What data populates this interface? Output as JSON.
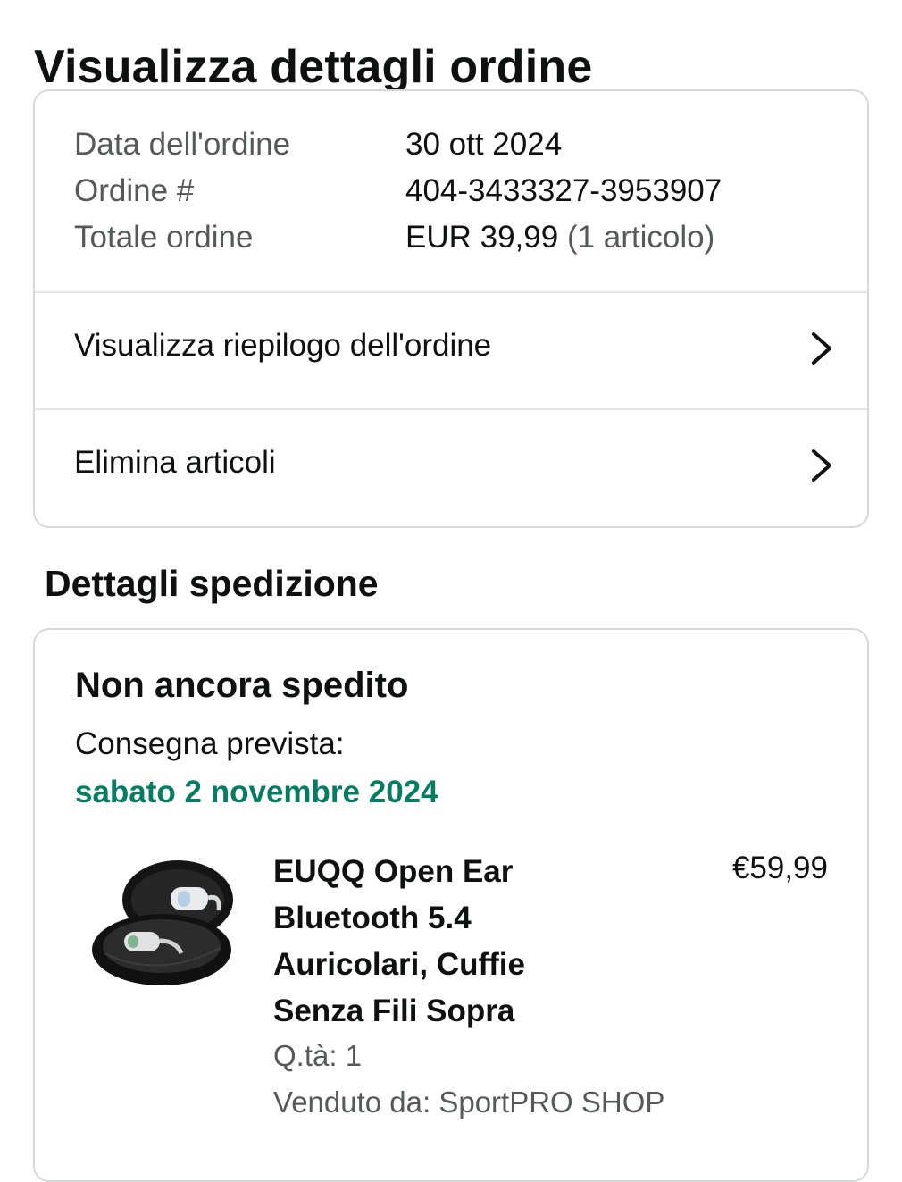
{
  "page": {
    "title": "Visualizza dettagli ordine"
  },
  "order_summary": {
    "rows": [
      {
        "label": "Data dell'ordine",
        "value": "30 ott 2024"
      },
      {
        "label": "Ordine #",
        "value": "404-3433327-3953907"
      },
      {
        "label": "Totale ordine",
        "value": "EUR 39,99",
        "value_extra": "(1 articolo)"
      }
    ],
    "links": [
      {
        "label": "Visualizza riepilogo dell'ordine",
        "icon": "chevron-right-icon"
      },
      {
        "label": "Elimina articoli",
        "icon": "chevron-right-icon"
      }
    ]
  },
  "shipment": {
    "section_title": "Dettagli spedizione",
    "status": "Non ancora spedito",
    "delivery_label": "Consegna prevista:",
    "delivery_date": "sabato 2 novembre 2024",
    "delivery_date_color": "#067d62",
    "item": {
      "image_icon": "earbuds-product-image",
      "title": "EUQQ Open Ear Bluetooth 5.4 Auricolari, Cuffie Senza Fili Sopra",
      "price": "€59,99",
      "quantity": "Q.tà: 1",
      "seller": "Venduto da: SportPRO SHOP"
    }
  }
}
